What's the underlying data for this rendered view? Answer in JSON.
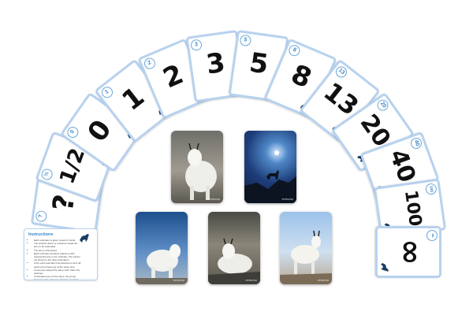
{
  "cards": [
    {
      "corner": "?",
      "value": "?"
    },
    {
      "corner": "½",
      "value": "1/2"
    },
    {
      "corner": "0",
      "value": "0"
    },
    {
      "corner": "1",
      "value": "1"
    },
    {
      "corner": "2",
      "value": "2"
    },
    {
      "corner": "3",
      "value": "3"
    },
    {
      "corner": "5",
      "value": "5"
    },
    {
      "corner": "8",
      "value": "8"
    },
    {
      "corner": "13",
      "value": "13"
    },
    {
      "corner": "20",
      "value": "20"
    },
    {
      "corner": "40",
      "value": "40"
    },
    {
      "corner": "100",
      "value": "100"
    },
    {
      "corner": "∞",
      "value": "∞"
    }
  ],
  "photo_cards": [
    {
      "title": "PLANNING POKER",
      "brand": "vertumo",
      "scene": "goat-portrait"
    },
    {
      "title": "PLANNING POKER",
      "brand": "vertumo",
      "scene": "goat-silhouette-night"
    },
    {
      "title": "PLANNING POKER",
      "brand": "vertumo",
      "scene": "goat-blue-sky"
    },
    {
      "title": "PLANNING POKER",
      "brand": "vertumo",
      "scene": "goat-lying"
    },
    {
      "title": "PLANNING POKER",
      "brand": "vertumo",
      "scene": "goat-standing"
    }
  ],
  "instructions": {
    "title": "Instructions",
    "items": [
      "Each estimator is given a deck of cards.",
      "The product owner or customer reads the item to be estimated.",
      "The item is discussed.",
      "Each estimator privately selects a card representing his or her estimate. The card is not shown to the other estimators.",
      "Once each estimator has selected a card, all cards are turned over at the same time.",
      "If everyone played the same card, that's the estimate.",
      "If estimates are not the same, the group discusses the estimates. Start by speaking to the outlying values.",
      "Repeat until estimates converge."
    ]
  },
  "colors": {
    "card_border": "#b7d2ee",
    "accent": "#3b86c6"
  }
}
